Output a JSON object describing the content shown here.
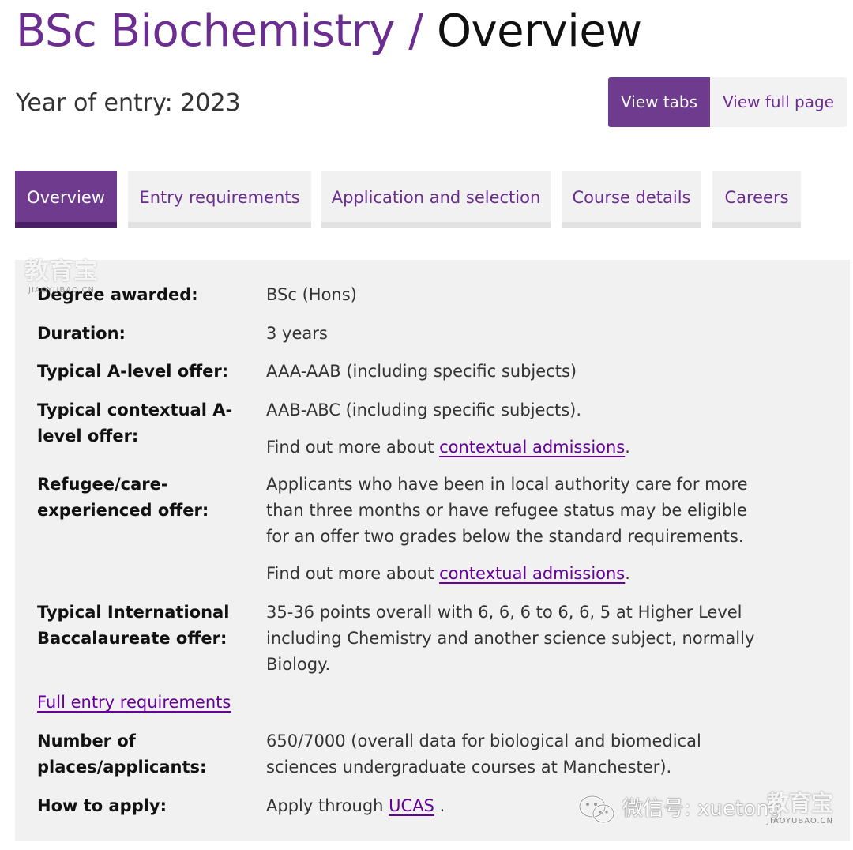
{
  "header": {
    "program": "BSc Biochemistry",
    "separator": "/",
    "section": "Overview",
    "year_of_entry": "Year of entry: 2023"
  },
  "view_toggle": {
    "tabs_label": "View tabs",
    "full_page_label": "View full page",
    "active": "View tabs"
  },
  "tabs": [
    {
      "label": "Overview",
      "active": true
    },
    {
      "label": "Entry requirements",
      "active": false
    },
    {
      "label": "Application and selection",
      "active": false
    },
    {
      "label": "Course details",
      "active": false
    },
    {
      "label": "Careers",
      "active": false
    }
  ],
  "overview": {
    "degree_awarded": {
      "label": "Degree awarded:",
      "value": "BSc (Hons)"
    },
    "duration": {
      "label": "Duration:",
      "value": "3 years"
    },
    "a_level": {
      "label": "Typical A-level offer:",
      "value": "AAA-AAB (including specific subjects)"
    },
    "contextual": {
      "label": "Typical contextual A-level offer:",
      "value": "AAB-ABC (including specific subjects).",
      "more_prefix": "Find out more about ",
      "more_link": "contextual admissions",
      "more_suffix": "."
    },
    "refugee": {
      "label": "Refugee/care-experienced offer:",
      "value": "Applicants who have been in local authority care for more than three months or have refugee status may be eligible for an offer two grades below the standard requirements.",
      "more_prefix": "Find out more about ",
      "more_link": "contextual admissions",
      "more_suffix": "."
    },
    "ib": {
      "label": "Typical International Baccalaureate offer:",
      "value": "35-36 points overall with 6, 6, 6 to 6, 6, 5 at Higher Level including Chemistry and another science subject, normally Biology."
    },
    "full_entry_link": "Full entry requirements",
    "places": {
      "label": "Number of places/applicants:",
      "value": "650/7000 (overall data for biological and biomedical sciences undergraduate courses at Manchester)."
    },
    "apply": {
      "label": "How to apply:",
      "prefix": "Apply through ",
      "link": "UCAS",
      "suffix": " ."
    }
  },
  "watermarks": {
    "logo_zh": "教育宝",
    "logo_en": "JIAOYUBAO.CN",
    "wechat_text": "微信号: xuetong",
    "brand_zh": "教育宝",
    "brand_en": "JIAOYUBAO.CN",
    "icon": "wechat-icon"
  },
  "colors": {
    "brand_purple": "#6e3b8e",
    "link_purple": "#660099",
    "panel_bg": "#f1f1f1"
  }
}
